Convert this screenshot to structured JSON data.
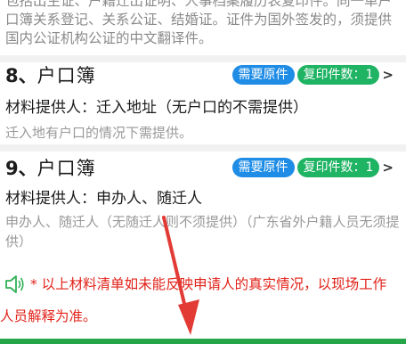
{
  "top_note": "包括出生证、户籍迁出证明、人事档案履历表复印件。同一单户口簿关系登记、关系公证、结婚证。证件为国外签发的，须提供国内公证机构公证的中文翻译件。",
  "items": [
    {
      "number": "8、",
      "title": "户口簿",
      "badge_original": "需要原件",
      "badge_copies": "复印件数：1",
      "chevron": ">",
      "provider": "材料提供人：迁入地址（无户口的不需提供）",
      "remark": "迁入地有户口的情况下需提供。"
    },
    {
      "number": "9、",
      "title": "户口簿",
      "badge_original": "需要原件",
      "badge_copies": "复印件数：1",
      "chevron": ">",
      "provider": "材料提供人：申办人、随迁人",
      "remark": "申办人、随迁人（无随迁人则不须提供）（广东省外户籍人员无须提供）"
    }
  ],
  "disclaimer": {
    "icon": "speaker-icon",
    "line1": "* 以上材料清单如未能反映申请人的真实情况，以现场工作",
    "line2": "人员解释为准。"
  },
  "colors": {
    "badge_blue": "#1f8ce6",
    "badge_green": "#1fb364",
    "disclaimer_red": "#e2231a",
    "arrow_red": "#e23a34",
    "bottom_bar": "#26a548"
  }
}
